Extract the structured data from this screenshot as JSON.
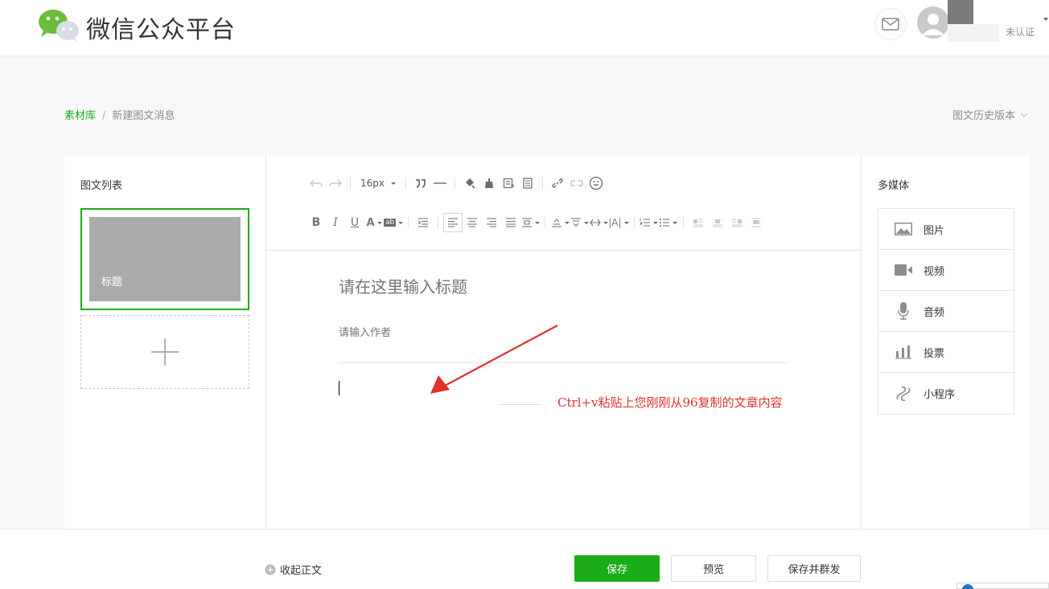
{
  "header": {
    "site_title": "微信公众平台",
    "account_status": "未认证"
  },
  "breadcrumb": {
    "root": "素材库",
    "separator": "/",
    "current": "新建图文消息"
  },
  "history_label": "图文历史版本",
  "left_panel": {
    "title": "图文列表",
    "article_title": "标题"
  },
  "editor": {
    "font_size": "16px",
    "title_placeholder": "请在这里输入标题",
    "author_placeholder": "请输入作者",
    "annotation": "Ctrl+v粘贴上您刚刚从96复制的文章内容"
  },
  "right_panel": {
    "title": "多媒体",
    "items": [
      {
        "label": "图片",
        "icon": "image-icon"
      },
      {
        "label": "视频",
        "icon": "video-icon"
      },
      {
        "label": "音频",
        "icon": "microphone-icon"
      },
      {
        "label": "投票",
        "icon": "poll-icon"
      },
      {
        "label": "小程序",
        "icon": "mini-program-icon"
      }
    ]
  },
  "footer": {
    "collapse_label": "收起正文",
    "save_label": "保存",
    "preview_label": "预览",
    "publish_label": "保存并群发"
  },
  "colors": {
    "accent": "#1aad19",
    "annotation": "#e0322c",
    "cover": "#ababab"
  }
}
